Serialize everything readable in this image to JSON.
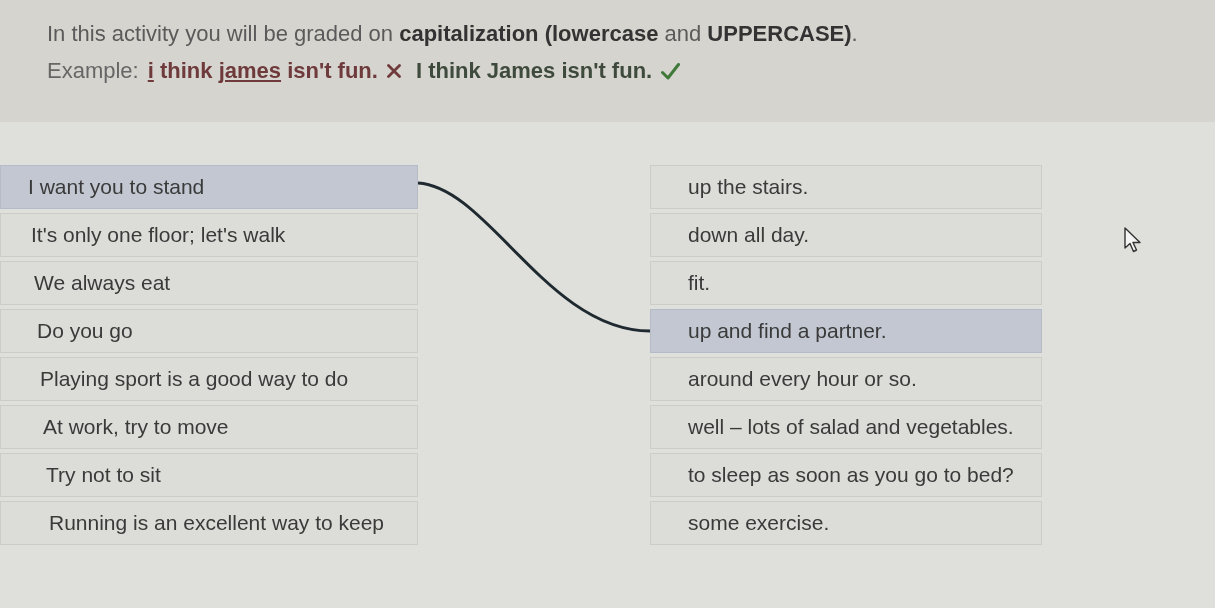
{
  "instruction": {
    "text": "In this activity you will be graded on **capitalization (lowercase** and **UPPERCASE)**."
  },
  "example": {
    "label": "Example:",
    "wrong": {
      "segments": [
        {
          "text": "i",
          "underlined": true
        },
        {
          "text": " think ",
          "underlined": false
        },
        {
          "text": "james",
          "underlined": true
        },
        {
          "text": " isn't fun.",
          "underlined": false
        }
      ]
    },
    "right": {
      "text": "I think James isn't fun."
    }
  },
  "left_items": [
    {
      "text": "I want you to stand",
      "selected": true
    },
    {
      "text": "It's only one floor; let's walk",
      "selected": false
    },
    {
      "text": "We always eat",
      "selected": false
    },
    {
      "text": "Do you go",
      "selected": false
    },
    {
      "text": "Playing sport is a good way to do",
      "selected": false
    },
    {
      "text": "At work, try to move",
      "selected": false
    },
    {
      "text": "Try not to sit",
      "selected": false
    },
    {
      "text": "Running is an excellent way to keep",
      "selected": false
    }
  ],
  "right_items": [
    {
      "text": "up the stairs.",
      "selected": false
    },
    {
      "text": "down all day.",
      "selected": false
    },
    {
      "text": "fit.",
      "selected": false
    },
    {
      "text": "up and find a partner.",
      "selected": true
    },
    {
      "text": "around every hour or so.",
      "selected": false
    },
    {
      "text": "well – lots of salad and vegetables.",
      "selected": false
    },
    {
      "text": "to sleep as soon as you go to bed?",
      "selected": false
    },
    {
      "text": "some exercise.",
      "selected": false
    }
  ]
}
